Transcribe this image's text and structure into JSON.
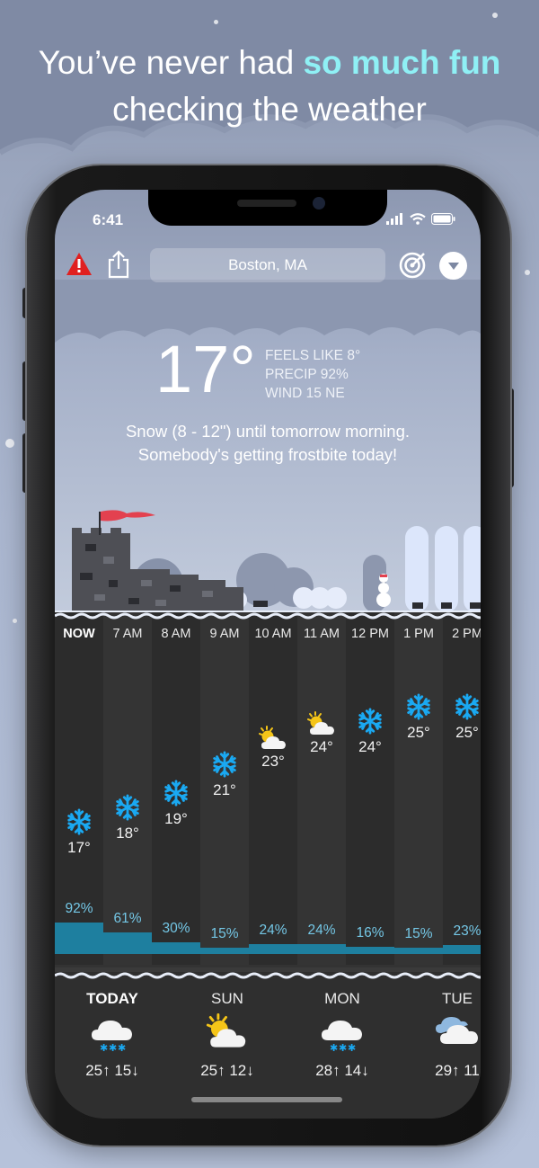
{
  "headline": {
    "part1": "You’ve never had ",
    "highlight": "so much fun",
    "line2": "checking the weather"
  },
  "status_bar": {
    "time": "6:41"
  },
  "top_bar": {
    "location": "Boston, MA"
  },
  "current": {
    "temp": "17°",
    "feels_like": "FEELS LIKE 8°",
    "precip": "PRECIP 92%",
    "wind": "WIND 15 NE",
    "summary_line1": "Snow (8 - 12\") until tomorrow morning.",
    "summary_line2": "Somebody's getting frostbite today!"
  },
  "hourly": [
    {
      "label": "NOW",
      "temp": "17°",
      "temp_value": 17,
      "icon": "snowflake-icon",
      "precip": "92%",
      "precip_value": 92
    },
    {
      "label": "7 AM",
      "temp": "18°",
      "temp_value": 18,
      "icon": "snowflake-icon",
      "precip": "61%",
      "precip_value": 61
    },
    {
      "label": "8 AM",
      "temp": "19°",
      "temp_value": 19,
      "icon": "snowflake-icon",
      "precip": "30%",
      "precip_value": 30
    },
    {
      "label": "9 AM",
      "temp": "21°",
      "temp_value": 21,
      "icon": "snowflake-icon",
      "precip": "15%",
      "precip_value": 15
    },
    {
      "label": "10 AM",
      "temp": "23°",
      "temp_value": 23,
      "icon": "partly-sunny-icon",
      "precip": "24%",
      "precip_value": 24
    },
    {
      "label": "11 AM",
      "temp": "24°",
      "temp_value": 24,
      "icon": "partly-sunny-icon",
      "precip": "24%",
      "precip_value": 24
    },
    {
      "label": "12 PM",
      "temp": "24°",
      "temp_value": 24,
      "icon": "snowflake-icon",
      "precip": "16%",
      "precip_value": 16
    },
    {
      "label": "1 PM",
      "temp": "25°",
      "temp_value": 25,
      "icon": "snowflake-icon",
      "precip": "15%",
      "precip_value": 15
    },
    {
      "label": "2 PM",
      "temp": "25°",
      "temp_value": 25,
      "icon": "snowflake-icon",
      "precip": "23%",
      "precip_value": 23
    }
  ],
  "daily": [
    {
      "day": "TODAY",
      "icon": "snow-cloud-icon",
      "range": "25↑ 15↓"
    },
    {
      "day": "SUN",
      "icon": "sun-cloud-icon",
      "range": "25↑ 12↓"
    },
    {
      "day": "MON",
      "icon": "snow-cloud-icon",
      "range": "28↑ 14↓"
    },
    {
      "day": "TUE",
      "icon": "cloud-icon",
      "range": "29↑ 11"
    }
  ],
  "colors": {
    "highlight": "#8ff0f5",
    "precip_text": "#74c7e6",
    "precip_bar": "#1e7f9f",
    "snowflake": "#1aa9f2",
    "alert": "#e02020"
  }
}
